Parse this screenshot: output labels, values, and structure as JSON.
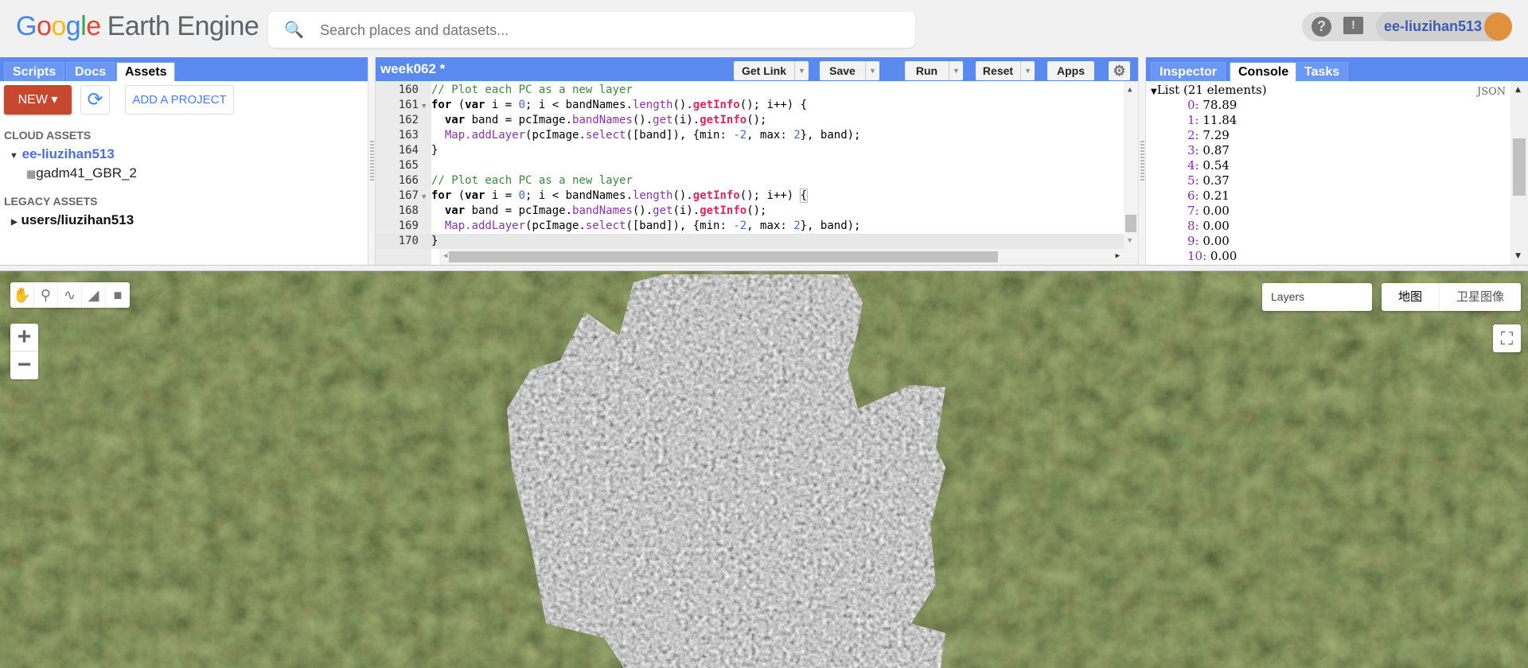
{
  "header": {
    "logo_google": "Google",
    "logo_product": "Earth Engine",
    "search_placeholder": "Search places and datasets...",
    "help_icon": "help-circle-icon",
    "feedback_icon": "feedback-icon",
    "user": "ee-liuzihan513"
  },
  "left_panel": {
    "tabs": [
      "Scripts",
      "Docs",
      "Assets"
    ],
    "active_tab": "Assets",
    "new_label": "NEW",
    "add_project_label": "ADD A PROJECT",
    "cloud_assets_label": "CLOUD ASSETS",
    "cloud_project": "ee-liuzihan513",
    "cloud_asset": "gadm41_GBR_2",
    "legacy_assets_label": "LEGACY ASSETS",
    "legacy_folder": "users/liuzihan513"
  },
  "editor": {
    "title": "week062 *",
    "buttons": {
      "get_link": "Get Link",
      "save": "Save",
      "run": "Run",
      "reset": "Reset",
      "apps": "Apps"
    },
    "lines": [
      {
        "n": "160",
        "text": "// Plot each PC as a new layer"
      },
      {
        "n": "161",
        "text": "for (var i = 0; i < bandNames.length().getInfo(); i++) {"
      },
      {
        "n": "162",
        "text": "  var band = pcImage.bandNames().get(i).getInfo();"
      },
      {
        "n": "163",
        "text": "  Map.addLayer(pcImage.select([band]), {min: -2, max: 2}, band);"
      },
      {
        "n": "164",
        "text": "}"
      },
      {
        "n": "165",
        "text": ""
      },
      {
        "n": "166",
        "text": "// Plot each PC as a new layer"
      },
      {
        "n": "167",
        "text": "for (var i = 0; i < bandNames.length().getInfo(); i++) {"
      },
      {
        "n": "168",
        "text": "  var band = pcImage.bandNames().get(i).getInfo();"
      },
      {
        "n": "169",
        "text": "  Map.addLayer(pcImage.select([band]), {min: -2, max: 2}, band);"
      },
      {
        "n": "170",
        "text": "}"
      }
    ]
  },
  "right_panel": {
    "tabs": [
      "Inspector",
      "Console",
      "Tasks"
    ],
    "active_tab": "Console",
    "list_header": "List (21 elements)",
    "json_label": "JSON",
    "items": [
      {
        "k": "0:",
        "v": "78.89"
      },
      {
        "k": "1:",
        "v": "11.84"
      },
      {
        "k": "2:",
        "v": "7.29"
      },
      {
        "k": "3:",
        "v": "0.87"
      },
      {
        "k": "4:",
        "v": "0.54"
      },
      {
        "k": "5:",
        "v": "0.37"
      },
      {
        "k": "6:",
        "v": "0.21"
      },
      {
        "k": "7:",
        "v": "0.00"
      },
      {
        "k": "8:",
        "v": "0.00"
      },
      {
        "k": "9:",
        "v": "0.00"
      },
      {
        "k": "10:",
        "v": "0.00"
      }
    ]
  },
  "map": {
    "layers_label": "Layers",
    "map_type": "地图",
    "satellite_type": "卫星图像",
    "zoom_in": "+",
    "zoom_out": "−"
  }
}
